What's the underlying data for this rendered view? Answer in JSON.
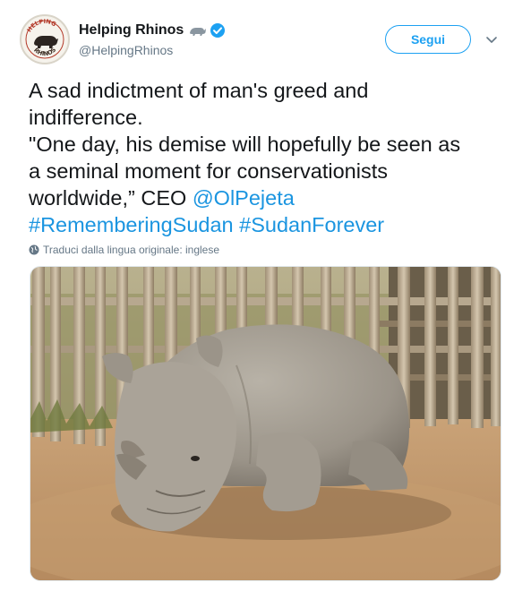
{
  "account": {
    "display_name": "Helping Rhinos",
    "handle": "@HelpingRhinos",
    "avatar_text_top": "HELPING",
    "avatar_text_bottom": "RHINOS",
    "verified_icon": "verified-badge-icon",
    "name_icon": "rhino-icon"
  },
  "follow": {
    "label": "Segui"
  },
  "menu": {
    "icon": "chevron-down-icon"
  },
  "tweet": {
    "line1": "A sad indictment of man's greed and",
    "line2": "indifference.",
    "line3": "\"One day, his demise will hopefully be seen as",
    "line4": "a seminal moment for conservationists",
    "line5_prefix": "worldwide,” CEO ",
    "mention": "@OlPejeta",
    "hashtag1": "#RememberingSudan",
    "hashtag2": "#SudanForever"
  },
  "translate": {
    "label": "Traduci dalla lingua originale: inglese",
    "icon": "globe-icon"
  },
  "media": {
    "description_icon": "rhino-photo"
  },
  "colors": {
    "accent": "#1da1f2",
    "link": "#1b95e0",
    "text": "#14171a",
    "secondary": "#657786"
  }
}
